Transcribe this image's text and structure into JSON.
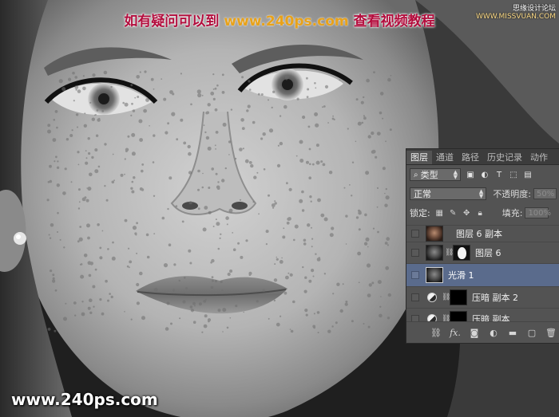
{
  "watermark": {
    "banner_prefix": "如有疑问可以到",
    "banner_url": "www.240ps.com",
    "banner_suffix": "查看视频教程",
    "corner_line1": "思缘设计论坛",
    "corner_line2": "WWW.MISSVUAN.COM",
    "footer_url": "www.240ps.com"
  },
  "layers_panel": {
    "tabs": [
      {
        "label": "图层",
        "active": true
      },
      {
        "label": "通道",
        "active": false
      },
      {
        "label": "路径",
        "active": false
      },
      {
        "label": "历史记录",
        "active": false
      },
      {
        "label": "动作",
        "active": false
      }
    ],
    "filter": {
      "label": "类型",
      "icons": [
        "image-filter-icon",
        "adjustment-filter-icon",
        "type-filter-icon",
        "shape-filter-icon",
        "smart-object-filter-icon"
      ]
    },
    "blend_mode": "正常",
    "opacity_label": "不透明度:",
    "opacity_value": "50%",
    "lock_label": "锁定:",
    "fill_label": "填充:",
    "fill_value": "100%",
    "layers": [
      {
        "name": "图层 6 副本",
        "kind": "pixel-color",
        "selected": false
      },
      {
        "name": "图层 6",
        "kind": "pixel-mask",
        "selected": false
      },
      {
        "name": "光滑 1",
        "kind": "pixel",
        "selected": true
      },
      {
        "name": "压暗 副本 2",
        "kind": "adjustment",
        "selected": false
      },
      {
        "name": "压暗 副本",
        "kind": "adjustment",
        "selected": false
      }
    ],
    "bottom_fx_label": "fx."
  }
}
